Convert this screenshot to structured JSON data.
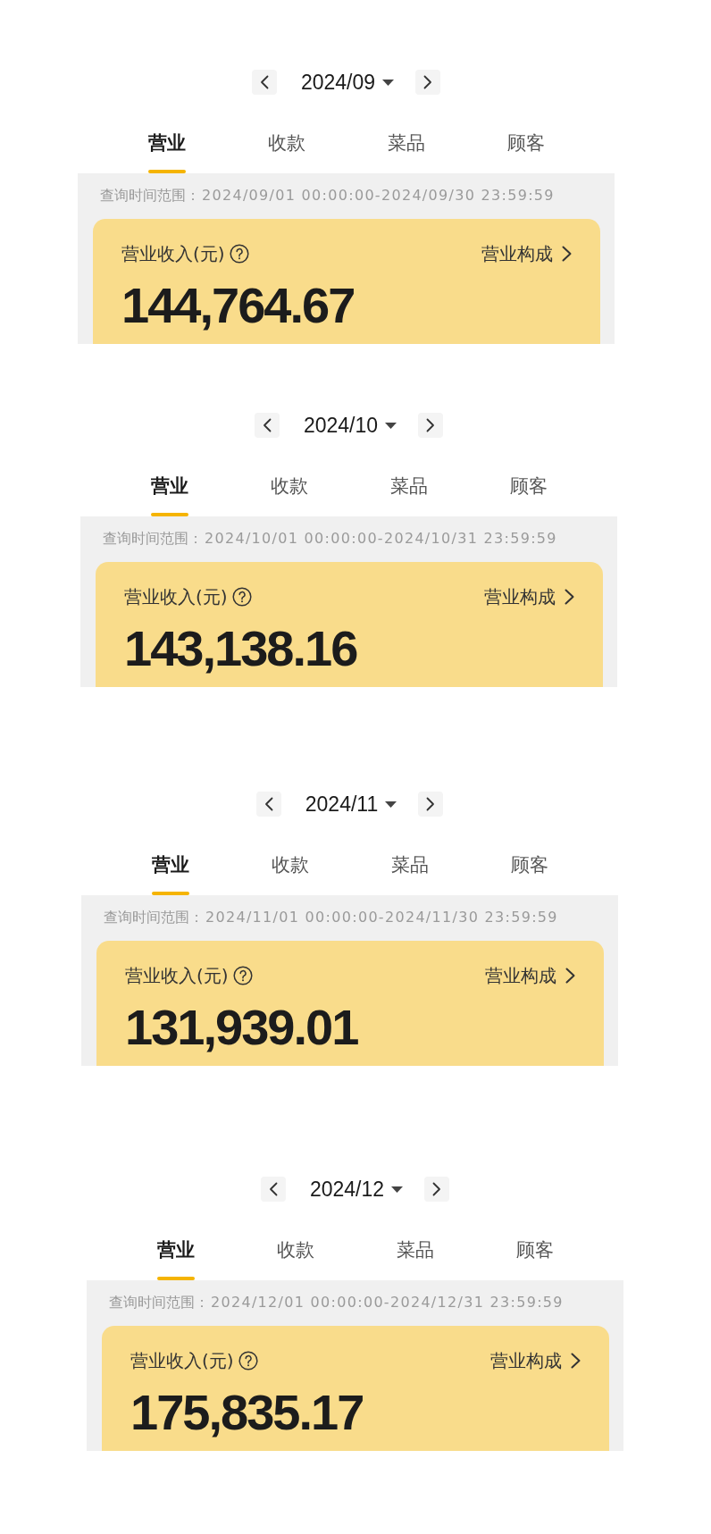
{
  "panels": [
    {
      "month": "2024/09",
      "tabs": [
        {
          "label": "营业",
          "selected": true
        },
        {
          "label": "收款",
          "selected": false
        },
        {
          "label": "菜品",
          "selected": false
        },
        {
          "label": "顾客",
          "selected": false
        }
      ],
      "query": {
        "label": "查询时间范围：",
        "range": "2024/09/01 00:00:00-2024/09/30 23:59:59"
      },
      "card": {
        "title": "营业收入(元)",
        "link": "营业构成",
        "amount": "144,764.67"
      }
    },
    {
      "month": "2024/10",
      "tabs": [
        {
          "label": "营业",
          "selected": true
        },
        {
          "label": "收款",
          "selected": false
        },
        {
          "label": "菜品",
          "selected": false
        },
        {
          "label": "顾客",
          "selected": false
        }
      ],
      "query": {
        "label": "查询时间范围：",
        "range": "2024/10/01 00:00:00-2024/10/31 23:59:59"
      },
      "card": {
        "title": "营业收入(元)",
        "link": "营业构成",
        "amount": "143,138.16"
      }
    },
    {
      "month": "2024/11",
      "tabs": [
        {
          "label": "营业",
          "selected": true
        },
        {
          "label": "收款",
          "selected": false
        },
        {
          "label": "菜品",
          "selected": false
        },
        {
          "label": "顾客",
          "selected": false
        }
      ],
      "query": {
        "label": "查询时间范围：",
        "range": "2024/11/01 00:00:00-2024/11/30 23:59:59"
      },
      "card": {
        "title": "营业收入(元)",
        "link": "营业构成",
        "amount": "131,939.01"
      }
    },
    {
      "month": "2024/12",
      "tabs": [
        {
          "label": "营业",
          "selected": true
        },
        {
          "label": "收款",
          "selected": false
        },
        {
          "label": "菜品",
          "selected": false
        },
        {
          "label": "顾客",
          "selected": false
        }
      ],
      "query": {
        "label": "查询时间范围：",
        "range": "2024/12/01 00:00:00-2024/12/31 23:59:59"
      },
      "card": {
        "title": "营业收入(元)",
        "link": "营业构成",
        "amount": "175,835.17"
      }
    }
  ]
}
